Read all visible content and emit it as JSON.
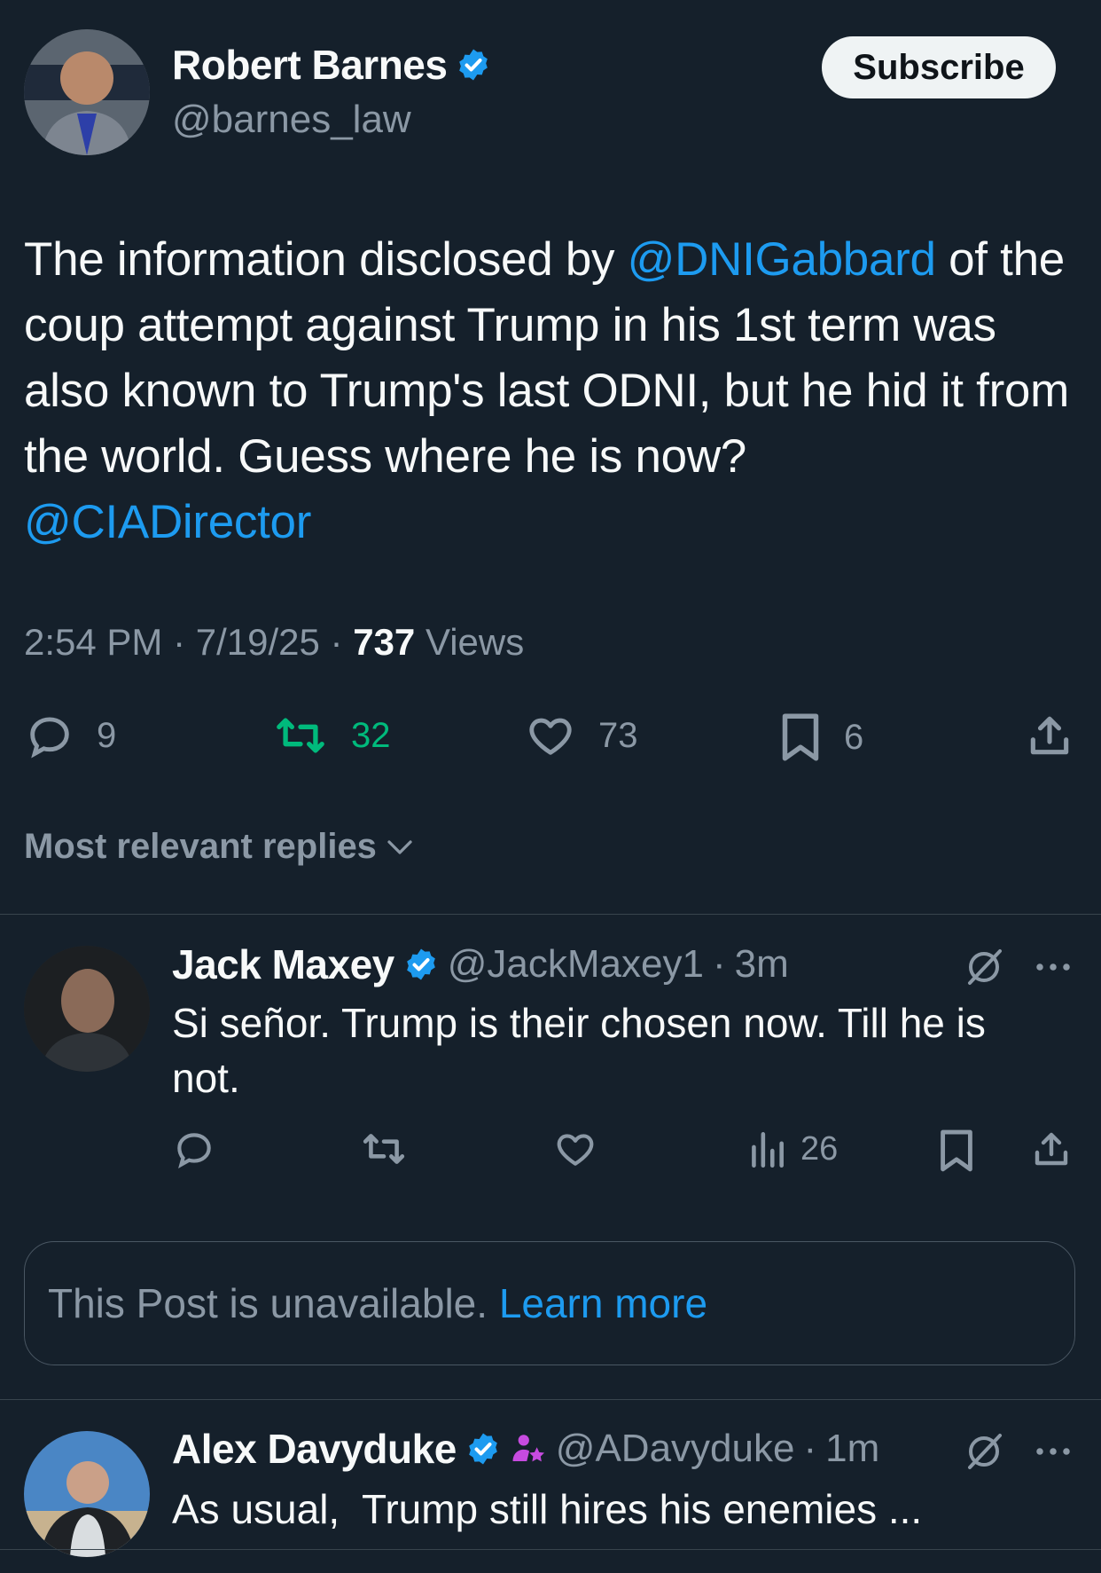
{
  "post": {
    "author_name": "Robert Barnes",
    "author_handle": "@barnes_law",
    "subscribe_label": "Subscribe",
    "text_mention_1": "@DNIGabbard",
    "text_part_1": "The information disclosed by ",
    "text_part_2": " of the coup attempt against Trump in his 1st term was also known to Trump's last ODNI, but he hid it from the world. Guess where he is now?",
    "text_mention_2": "@CIADirector",
    "time": "2:54 PM",
    "date": "7/19/25",
    "views_count": "737",
    "views_label": "Views",
    "replies": "9",
    "reposts": "32",
    "likes": "73",
    "bookmarks": "6"
  },
  "sort_label": "Most relevant replies",
  "replies": [
    {
      "name": "Jack Maxey",
      "handle": "@JackMaxey1",
      "time": "3m",
      "text": "Si señor. Trump is their chosen now. Till he is not.",
      "views": "26"
    },
    {
      "name": "Alex Davyduke",
      "handle": "@ADavyduke",
      "time": "1m",
      "text": "As usual,  Trump still hires his enemies ..."
    }
  ],
  "unavailable": {
    "text": "This Post is unavailable.",
    "link": "Learn more"
  },
  "colors": {
    "background": "#15202b",
    "link": "#1d9bf0",
    "repost_active": "#00ba7c",
    "muted": "#8b98a5",
    "verified": "#1d9bf0"
  }
}
